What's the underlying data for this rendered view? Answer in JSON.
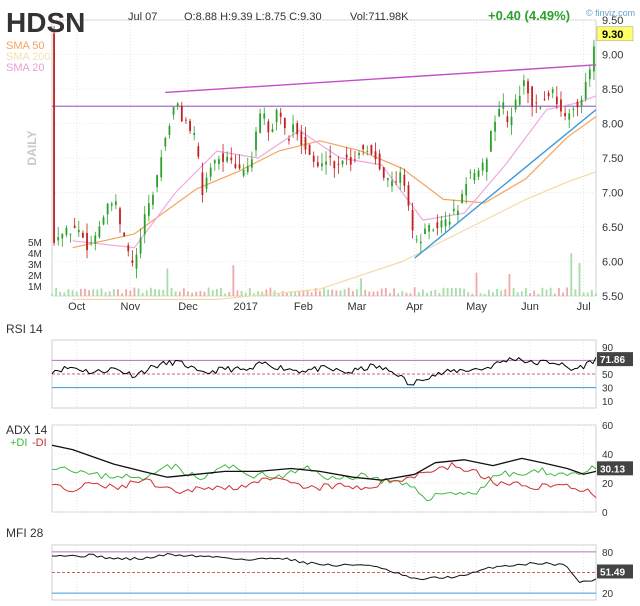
{
  "header": {
    "ticker": "HDSN",
    "date": "Jul 07",
    "ohlc": "O:8.88  H:9.39  L:8.75  C:9.30",
    "volume": "Vol:711.98K",
    "change": "+0.40 (4.49%)",
    "watermark": "© finviz.com",
    "timeframe": "DAILY"
  },
  "legend": [
    {
      "label": "SMA 50",
      "color": "#f4a460"
    },
    {
      "label": "SMA 200",
      "color": "#f5deb3"
    },
    {
      "label": "SMA 20",
      "color": "#e8a0d8"
    }
  ],
  "colors": {
    "up": "#2ca02c",
    "down": "#c02020",
    "trendline": "#c050c8",
    "support": "#3a9ad9",
    "rsi_line": "#000000",
    "plus_di": "#40b840",
    "minus_di": "#d03030",
    "price_badge": "#ffff66"
  },
  "chart_data": [
    {
      "type": "candlestick",
      "name": "price",
      "x_labels": [
        "Oct",
        "Nov",
        "Dec",
        "2017",
        "Feb",
        "Mar",
        "Apr",
        "May",
        "Jun",
        "Jul"
      ],
      "y_ticks": [
        "9.50",
        "9.00",
        "8.50",
        "8.00",
        "7.50",
        "7.00",
        "6.50",
        "6.00",
        "5.50"
      ],
      "volume_ticks": [
        "5M",
        "4M",
        "3M",
        "2M",
        "1M"
      ],
      "ylim": [
        5.5,
        9.5
      ],
      "last_price": "9.30",
      "close_path": [
        [
          0,
          6.35
        ],
        [
          6,
          6.4
        ],
        [
          12,
          6.5
        ],
        [
          18,
          6.2
        ],
        [
          24,
          6.6
        ],
        [
          30,
          6.9
        ],
        [
          36,
          6.2
        ],
        [
          40,
          5.9
        ],
        [
          44,
          6.5
        ],
        [
          50,
          7.1
        ],
        [
          55,
          7.8
        ],
        [
          60,
          8.3
        ],
        [
          63,
          8.1
        ],
        [
          66,
          8.0
        ],
        [
          70,
          7.7
        ],
        [
          73,
          7.0
        ],
        [
          78,
          7.5
        ],
        [
          84,
          7.5
        ],
        [
          90,
          7.3
        ],
        [
          96,
          7.4
        ],
        [
          102,
          8.2
        ],
        [
          106,
          7.8
        ],
        [
          110,
          8.3
        ],
        [
          114,
          7.7
        ],
        [
          118,
          8.0
        ],
        [
          122,
          7.7
        ],
        [
          126,
          7.5
        ],
        [
          130,
          7.3
        ],
        [
          134,
          7.6
        ],
        [
          138,
          7.3
        ],
        [
          142,
          7.6
        ],
        [
          146,
          7.4
        ],
        [
          150,
          7.7
        ],
        [
          154,
          7.6
        ],
        [
          158,
          7.5
        ],
        [
          162,
          7.2
        ],
        [
          166,
          7.1
        ],
        [
          170,
          7.3
        ],
        [
          174,
          6.7
        ],
        [
          176,
          6.2
        ],
        [
          180,
          6.4
        ],
        [
          186,
          6.5
        ],
        [
          192,
          6.6
        ],
        [
          198,
          6.8
        ],
        [
          202,
          7.3
        ],
        [
          206,
          7.2
        ],
        [
          210,
          7.4
        ],
        [
          214,
          8.0
        ],
        [
          218,
          8.3
        ],
        [
          222,
          8.0
        ],
        [
          226,
          8.4
        ],
        [
          230,
          8.6
        ],
        [
          234,
          8.2
        ],
        [
          238,
          8.3
        ],
        [
          242,
          8.5
        ],
        [
          246,
          8.3
        ],
        [
          250,
          8.0
        ],
        [
          254,
          8.3
        ],
        [
          258,
          8.4
        ],
        [
          262,
          8.9
        ],
        [
          264,
          9.3
        ]
      ],
      "sma50": [
        [
          10,
          6.2
        ],
        [
          40,
          6.4
        ],
        [
          70,
          7.05
        ],
        [
          90,
          7.3
        ],
        [
          110,
          7.6
        ],
        [
          130,
          7.75
        ],
        [
          150,
          7.6
        ],
        [
          170,
          7.35
        ],
        [
          190,
          6.9
        ],
        [
          210,
          6.85
        ],
        [
          230,
          7.2
        ],
        [
          250,
          7.8
        ],
        [
          264,
          8.1
        ]
      ],
      "sma200": [
        [
          10,
          5.45
        ],
        [
          80,
          5.45
        ],
        [
          130,
          5.6
        ],
        [
          170,
          6.0
        ],
        [
          200,
          6.45
        ],
        [
          230,
          6.9
        ],
        [
          250,
          7.15
        ],
        [
          264,
          7.3
        ]
      ],
      "sma20": [
        [
          10,
          6.3
        ],
        [
          40,
          6.2
        ],
        [
          60,
          7.0
        ],
        [
          80,
          7.6
        ],
        [
          100,
          7.5
        ],
        [
          120,
          7.9
        ],
        [
          140,
          7.5
        ],
        [
          160,
          7.4
        ],
        [
          180,
          6.6
        ],
        [
          200,
          6.7
        ],
        [
          220,
          7.4
        ],
        [
          240,
          8.2
        ],
        [
          255,
          8.3
        ],
        [
          264,
          8.4
        ]
      ],
      "annotations": {
        "resistance_from": [
          55,
          8.45
        ],
        "resistance_to": [
          264,
          8.85
        ],
        "support_from": [
          176,
          6.05
        ],
        "support_to": [
          264,
          8.2
        ],
        "horizontal_level": 8.25
      }
    },
    {
      "type": "line",
      "name": "RSI 14",
      "y_ticks": [
        "90",
        "70",
        "50",
        "30",
        "10"
      ],
      "ylim": [
        0,
        100
      ],
      "levels": [
        70,
        50,
        30
      ],
      "last_value": "71.86",
      "values": [
        [
          0,
          55
        ],
        [
          10,
          60
        ],
        [
          20,
          52
        ],
        [
          30,
          58
        ],
        [
          40,
          48
        ],
        [
          50,
          62
        ],
        [
          60,
          68
        ],
        [
          66,
          62
        ],
        [
          72,
          50
        ],
        [
          84,
          58
        ],
        [
          96,
          55
        ],
        [
          102,
          66
        ],
        [
          110,
          60
        ],
        [
          120,
          55
        ],
        [
          132,
          58
        ],
        [
          144,
          52
        ],
        [
          156,
          62
        ],
        [
          168,
          50
        ],
        [
          174,
          32
        ],
        [
          180,
          45
        ],
        [
          196,
          55
        ],
        [
          210,
          58
        ],
        [
          220,
          70
        ],
        [
          226,
          74
        ],
        [
          232,
          66
        ],
        [
          244,
          68
        ],
        [
          252,
          56
        ],
        [
          258,
          62
        ],
        [
          264,
          72
        ]
      ]
    },
    {
      "type": "line",
      "name": "ADX 14",
      "y_ticks": [
        "60",
        "40",
        "20",
        "0"
      ],
      "ylim": [
        0,
        60
      ],
      "legend_plus": "+DI",
      "legend_minus": "-DI",
      "last_value": "30.13",
      "adx": [
        [
          0,
          46
        ],
        [
          10,
          43
        ],
        [
          20,
          38
        ],
        [
          30,
          33
        ],
        [
          44,
          28
        ],
        [
          56,
          24
        ],
        [
          70,
          26
        ],
        [
          84,
          28
        ],
        [
          100,
          28
        ],
        [
          116,
          30
        ],
        [
          130,
          28
        ],
        [
          146,
          24
        ],
        [
          160,
          22
        ],
        [
          176,
          26
        ],
        [
          186,
          34
        ],
        [
          200,
          36
        ],
        [
          214,
          32
        ],
        [
          228,
          37
        ],
        [
          238,
          34
        ],
        [
          250,
          30
        ],
        [
          258,
          26
        ],
        [
          264,
          28
        ]
      ],
      "plus_di": [
        [
          0,
          32
        ],
        [
          10,
          30
        ],
        [
          20,
          25
        ],
        [
          34,
          25
        ],
        [
          44,
          22
        ],
        [
          54,
          33
        ],
        [
          62,
          30
        ],
        [
          72,
          22
        ],
        [
          84,
          32
        ],
        [
          96,
          26
        ],
        [
          110,
          24
        ],
        [
          124,
          30
        ],
        [
          138,
          22
        ],
        [
          150,
          26
        ],
        [
          160,
          22
        ],
        [
          172,
          18
        ],
        [
          182,
          10
        ],
        [
          194,
          14
        ],
        [
          204,
          12
        ],
        [
          216,
          26
        ],
        [
          228,
          26
        ],
        [
          238,
          28
        ],
        [
          250,
          26
        ],
        [
          258,
          28
        ],
        [
          264,
          30
        ]
      ],
      "minus_di": [
        [
          0,
          18
        ],
        [
          10,
          14
        ],
        [
          20,
          20
        ],
        [
          30,
          16
        ],
        [
          44,
          22
        ],
        [
          54,
          16
        ],
        [
          62,
          12
        ],
        [
          74,
          18
        ],
        [
          84,
          16
        ],
        [
          96,
          20
        ],
        [
          110,
          22
        ],
        [
          124,
          16
        ],
        [
          138,
          18
        ],
        [
          150,
          16
        ],
        [
          160,
          20
        ],
        [
          172,
          24
        ],
        [
          182,
          28
        ],
        [
          194,
          32
        ],
        [
          204,
          28
        ],
        [
          216,
          20
        ],
        [
          228,
          18
        ],
        [
          238,
          18
        ],
        [
          250,
          18
        ],
        [
          258,
          16
        ],
        [
          264,
          10
        ]
      ]
    },
    {
      "type": "line",
      "name": "MFI 28",
      "y_ticks": [
        "80",
        "20"
      ],
      "ylim": [
        10,
        90
      ],
      "levels": [
        80,
        50,
        20
      ],
      "last_value": "51.49",
      "values": [
        [
          0,
          76
        ],
        [
          10,
          74
        ],
        [
          20,
          75
        ],
        [
          30,
          70
        ],
        [
          44,
          70
        ],
        [
          56,
          76
        ],
        [
          70,
          74
        ],
        [
          84,
          72
        ],
        [
          96,
          68
        ],
        [
          110,
          72
        ],
        [
          124,
          64
        ],
        [
          138,
          60
        ],
        [
          152,
          62
        ],
        [
          166,
          50
        ],
        [
          176,
          40
        ],
        [
          186,
          42
        ],
        [
          200,
          45
        ],
        [
          214,
          58
        ],
        [
          228,
          62
        ],
        [
          238,
          64
        ],
        [
          250,
          60
        ],
        [
          256,
          35
        ],
        [
          264,
          40
        ]
      ]
    }
  ]
}
